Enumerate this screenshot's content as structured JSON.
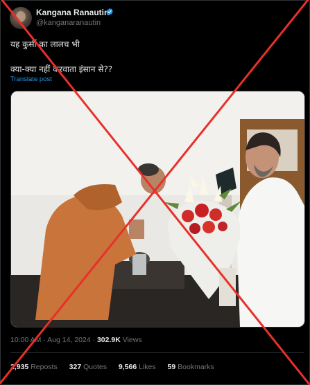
{
  "author": {
    "display_name": "Kangana Ranautin",
    "handle": "@kanganaranautin",
    "verified_icon": "verified-badge-icon"
  },
  "tweet": {
    "line1": "यह कुर्सी का लालच भी",
    "line2": "क्या-क्या नहीं करवाता इंसान से??",
    "translate_label": "Translate post"
  },
  "meta": {
    "time": "10:00 AM",
    "separator": "·",
    "date": "Aug 14, 2024",
    "views_count": "302.9K",
    "views_label": "Views"
  },
  "stats": {
    "reposts_count": "2,935",
    "reposts_label": "Reposts",
    "quotes_count": "327",
    "quotes_label": "Quotes",
    "likes_count": "9,566",
    "likes_label": "Likes",
    "bookmarks_count": "59",
    "bookmarks_label": "Bookmarks"
  },
  "colors": {
    "background": "#000000",
    "link": "#1d9bf0",
    "muted_text": "#71767b",
    "cross_overlay": "#e8302a"
  }
}
